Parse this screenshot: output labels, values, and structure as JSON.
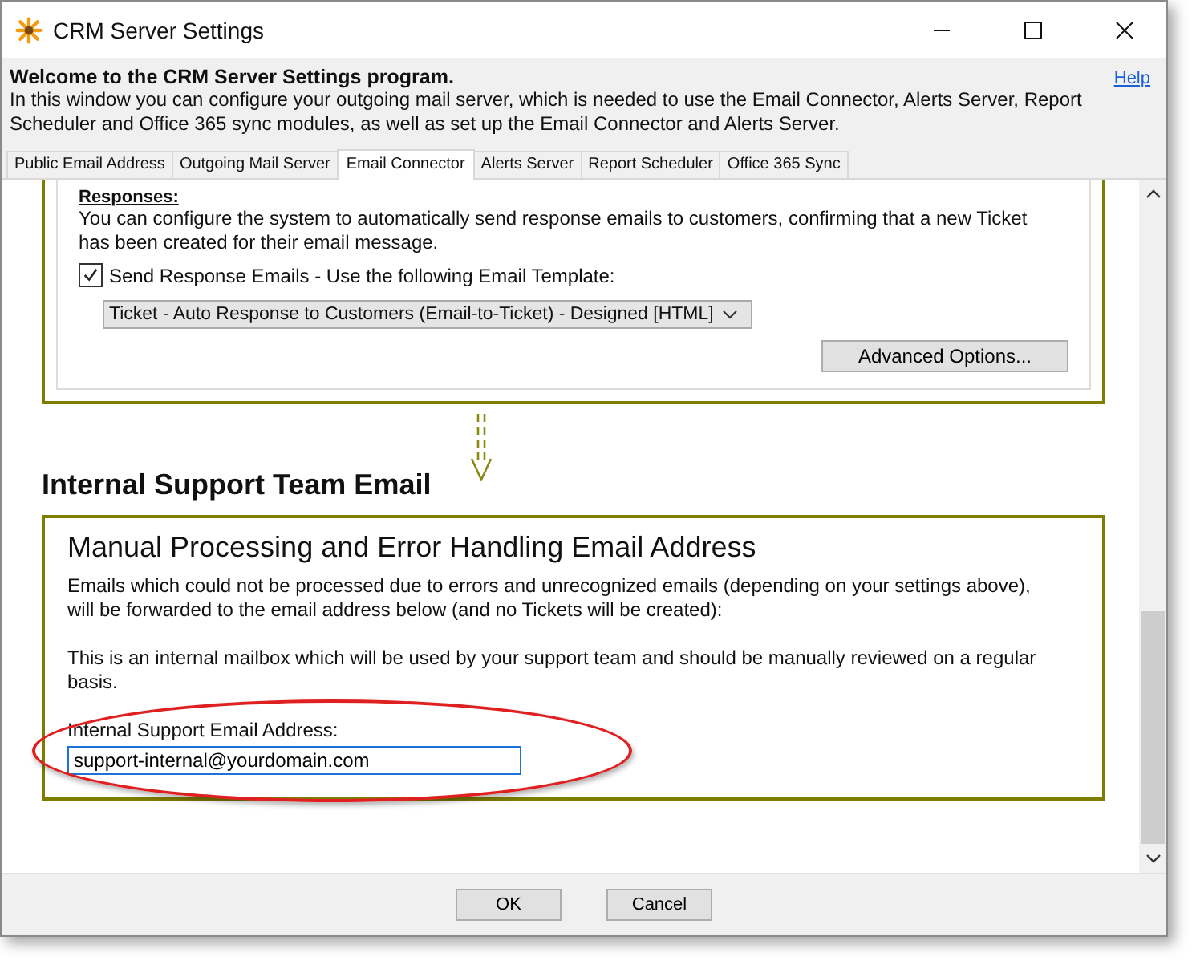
{
  "window": {
    "title": "CRM Server Settings"
  },
  "header": {
    "title": "Welcome to the CRM Server Settings program.",
    "description": "In this window you can configure your outgoing mail server, which is needed to use the Email Connector, Alerts Server, Report Scheduler and Office 365 sync modules, as well as set up the Email Connector and Alerts Server.",
    "help_link": "Help"
  },
  "tabs": [
    {
      "label": "Public Email Address",
      "selected": false
    },
    {
      "label": "Outgoing Mail Server",
      "selected": false
    },
    {
      "label": "Email Connector",
      "selected": true
    },
    {
      "label": "Alerts Server",
      "selected": false
    },
    {
      "label": "Report Scheduler",
      "selected": false
    },
    {
      "label": "Office 365 Sync",
      "selected": false
    }
  ],
  "responses": {
    "heading": "Responses:",
    "description": "You can configure the system to automatically send response emails to customers, confirming that a new Ticket has been created for their email message.",
    "send_checkbox": {
      "label": "Send Response Emails - Use the following Email Template:",
      "checked": true
    },
    "template_dropdown": "Ticket - Auto Response to Customers (Email-to-Ticket) - Designed [HTML]",
    "advanced_button": "Advanced Options..."
  },
  "internal": {
    "section_title": "Internal Support Team Email",
    "card_title": "Manual Processing and Error Handling Email Address",
    "paragraphs": [
      "Emails which could not be processed due to errors and unrecognized emails (depending on your settings above), will be forwarded to the email address below (and no Tickets will be created):",
      "This is an internal mailbox which will be used by your support team and should be manually reviewed on a regular basis."
    ],
    "field_label": "Internal Support Email Address:",
    "field_value": "support-internal@yourdomain.com"
  },
  "buttons": [
    "OK",
    "Cancel"
  ]
}
